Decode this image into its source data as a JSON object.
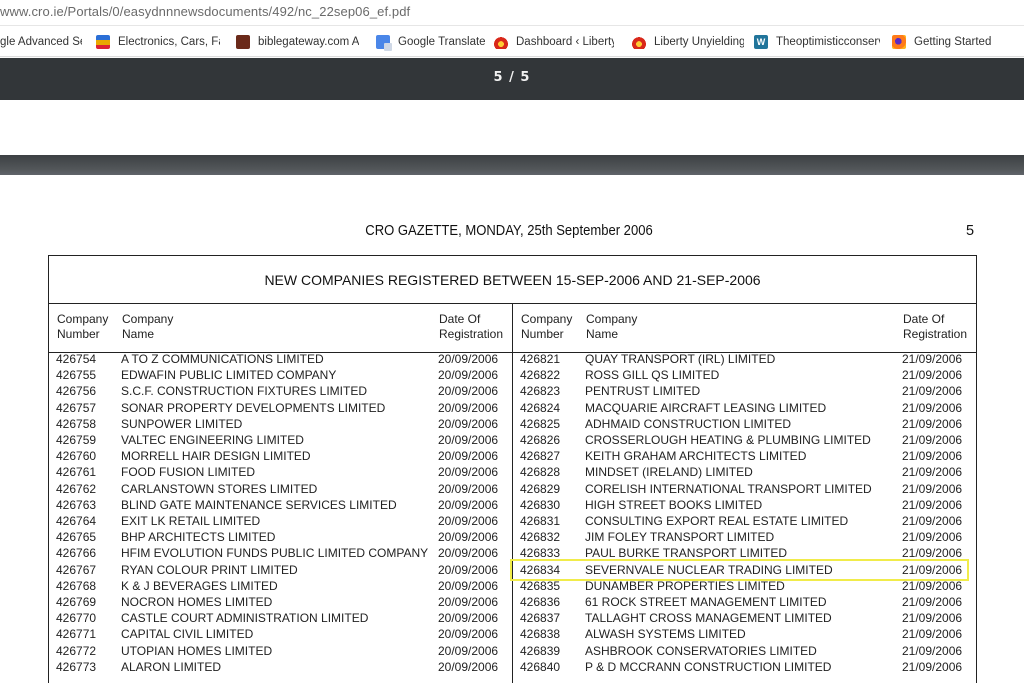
{
  "browser": {
    "url": "www.cro.ie/Portals/0/easydnnnewsdocuments/492/nc_22sep06_ef.pdf",
    "bookmarks": [
      {
        "label": "gle Advanced Se",
        "icon": "google-icon"
      },
      {
        "label": "Electronics, Cars, Fash",
        "icon": "shopping-bag-icon"
      },
      {
        "label": "biblegateway.com A",
        "icon": "bible-icon"
      },
      {
        "label": "Google Translate",
        "icon": "translate-icon"
      },
      {
        "label": "Dashboard ‹ Liberty U",
        "icon": "flame-icon"
      },
      {
        "label": "Liberty Unyielding",
        "icon": "flame-icon"
      },
      {
        "label": "Theoptimisticconserv",
        "icon": "wordpress-icon"
      },
      {
        "label": "Getting Started",
        "icon": "firefox-icon"
      }
    ]
  },
  "pdf": {
    "page_indicator": "5 / 5"
  },
  "document": {
    "gazette_title": "CRO GAZETTE, MONDAY, 25th September 2006",
    "page_number": "5",
    "table_title": "NEW COMPANIES REGISTERED BETWEEN 15-SEP-2006 AND 21-SEP-2006",
    "col_headers": {
      "number": [
        "Company",
        "Number"
      ],
      "name": [
        "Company",
        "Name"
      ],
      "date": [
        "Date Of",
        "Registration"
      ]
    },
    "left_rows": [
      {
        "number": "426754",
        "name": "A TO Z COMMUNICATIONS LIMITED",
        "date": "20/09/2006"
      },
      {
        "number": "426755",
        "name": "EDWAFIN PUBLIC LIMITED COMPANY",
        "date": "20/09/2006"
      },
      {
        "number": "426756",
        "name": "S.C.F. CONSTRUCTION FIXTURES LIMITED",
        "date": "20/09/2006"
      },
      {
        "number": "426757",
        "name": "SONAR PROPERTY DEVELOPMENTS LIMITED",
        "date": "20/09/2006"
      },
      {
        "number": "426758",
        "name": "SUNPOWER LIMITED",
        "date": "20/09/2006"
      },
      {
        "number": "426759",
        "name": "VALTEC ENGINEERING LIMITED",
        "date": "20/09/2006"
      },
      {
        "number": "426760",
        "name": "MORRELL HAIR DESIGN LIMITED",
        "date": "20/09/2006"
      },
      {
        "number": "426761",
        "name": "FOOD FUSION LIMITED",
        "date": "20/09/2006"
      },
      {
        "number": "426762",
        "name": "CARLANSTOWN STORES LIMITED",
        "date": "20/09/2006"
      },
      {
        "number": "426763",
        "name": "BLIND GATE MAINTENANCE SERVICES LIMITED",
        "date": "20/09/2006"
      },
      {
        "number": "426764",
        "name": "EXIT LK RETAIL LIMITED",
        "date": "20/09/2006"
      },
      {
        "number": "426765",
        "name": "BHP ARCHITECTS LIMITED",
        "date": "20/09/2006"
      },
      {
        "number": "426766",
        "name": "HFIM EVOLUTION FUNDS PUBLIC LIMITED COMPANY",
        "date": "20/09/2006"
      },
      {
        "number": "426767",
        "name": "RYAN COLOUR PRINT LIMITED",
        "date": "20/09/2006"
      },
      {
        "number": "426768",
        "name": "K & J BEVERAGES LIMITED",
        "date": "20/09/2006"
      },
      {
        "number": "426769",
        "name": "NOCRON HOMES LIMITED",
        "date": "20/09/2006"
      },
      {
        "number": "426770",
        "name": "CASTLE COURT ADMINISTRATION LIMITED",
        "date": "20/09/2006"
      },
      {
        "number": "426771",
        "name": "CAPITAL CIVIL LIMITED",
        "date": "20/09/2006"
      },
      {
        "number": "426772",
        "name": "UTOPIAN HOMES LIMITED",
        "date": "20/09/2006"
      },
      {
        "number": "426773",
        "name": "ALARON LIMITED",
        "date": "20/09/2006"
      }
    ],
    "right_rows": [
      {
        "number": "426821",
        "name": "QUAY TRANSPORT (IRL) LIMITED",
        "date": "21/09/2006"
      },
      {
        "number": "426822",
        "name": "ROSS GILL QS LIMITED",
        "date": "21/09/2006"
      },
      {
        "number": "426823",
        "name": "PENTRUST LIMITED",
        "date": "21/09/2006"
      },
      {
        "number": "426824",
        "name": "MACQUARIE AIRCRAFT LEASING LIMITED",
        "date": "21/09/2006"
      },
      {
        "number": "426825",
        "name": "ADHMAID CONSTRUCTION LIMITED",
        "date": "21/09/2006"
      },
      {
        "number": "426826",
        "name": "CROSSERLOUGH HEATING & PLUMBING LIMITED",
        "date": "21/09/2006"
      },
      {
        "number": "426827",
        "name": "KEITH GRAHAM ARCHITECTS LIMITED",
        "date": "21/09/2006"
      },
      {
        "number": "426828",
        "name": "MINDSET (IRELAND) LIMITED",
        "date": "21/09/2006"
      },
      {
        "number": "426829",
        "name": "CORELISH INTERNATIONAL TRANSPORT LIMITED",
        "date": "21/09/2006"
      },
      {
        "number": "426830",
        "name": "HIGH STREET BOOKS LIMITED",
        "date": "21/09/2006"
      },
      {
        "number": "426831",
        "name": "CONSULTING EXPORT REAL ESTATE LIMITED",
        "date": "21/09/2006"
      },
      {
        "number": "426832",
        "name": "JIM FOLEY TRANSPORT LIMITED",
        "date": "21/09/2006"
      },
      {
        "number": "426833",
        "name": "PAUL BURKE TRANSPORT LIMITED",
        "date": "21/09/2006"
      },
      {
        "number": "426834",
        "name": "SEVERNVALE NUCLEAR TRADING LIMITED",
        "date": "21/09/2006"
      },
      {
        "number": "426835",
        "name": "DUNAMBER PROPERTIES LIMITED",
        "date": "21/09/2006"
      },
      {
        "number": "426836",
        "name": "61 ROCK STREET MANAGEMENT LIMITED",
        "date": "21/09/2006"
      },
      {
        "number": "426837",
        "name": "TALLAGHT CROSS MANAGEMENT LIMITED",
        "date": "21/09/2006"
      },
      {
        "number": "426838",
        "name": "ALWASH SYSTEMS LIMITED",
        "date": "21/09/2006"
      },
      {
        "number": "426839",
        "name": "ASHBROOK CONSERVATORIES LIMITED",
        "date": "21/09/2006"
      },
      {
        "number": "426840",
        "name": "P & D MCCRANN CONSTRUCTION LIMITED",
        "date": "21/09/2006"
      }
    ],
    "highlight_color": "#f1ec4a"
  }
}
